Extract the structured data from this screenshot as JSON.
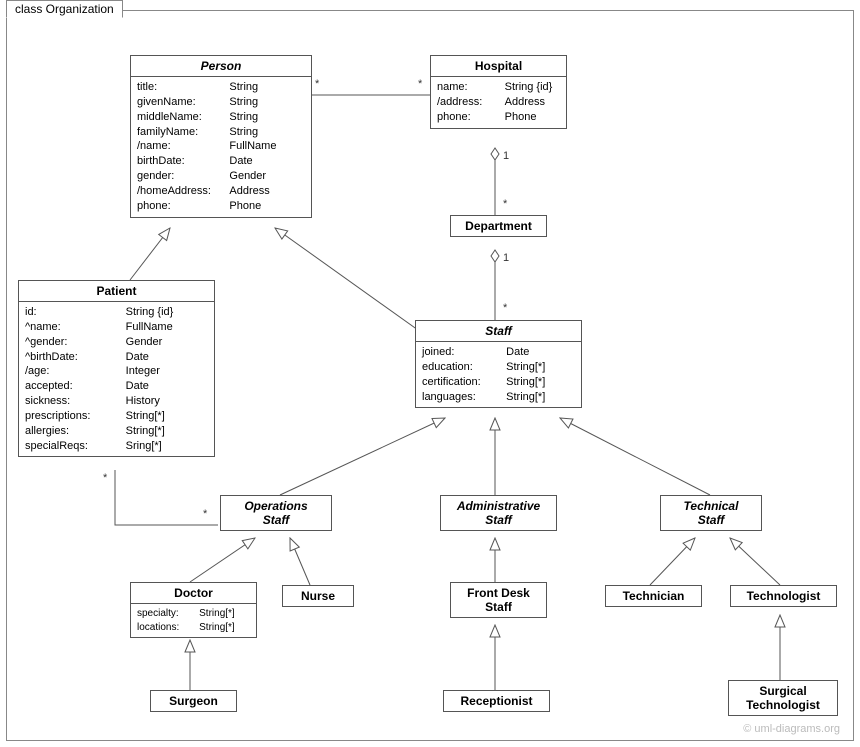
{
  "frameTitle": "class Organization",
  "watermark": "© uml-diagrams.org",
  "classes": {
    "person": {
      "name": "Person",
      "attrs": [
        {
          "n": "title:",
          "t": "String"
        },
        {
          "n": "givenName:",
          "t": "String"
        },
        {
          "n": "middleName:",
          "t": "String"
        },
        {
          "n": "familyName:",
          "t": "String"
        },
        {
          "n": "/name:",
          "t": "FullName"
        },
        {
          "n": "birthDate:",
          "t": "Date"
        },
        {
          "n": "gender:",
          "t": "Gender"
        },
        {
          "n": "/homeAddress:",
          "t": "Address"
        },
        {
          "n": "phone:",
          "t": "Phone"
        }
      ]
    },
    "hospital": {
      "name": "Hospital",
      "attrs": [
        {
          "n": "name:",
          "t": "String {id}"
        },
        {
          "n": "/address:",
          "t": "Address"
        },
        {
          "n": "phone:",
          "t": "Phone"
        }
      ]
    },
    "department": {
      "name": "Department"
    },
    "patient": {
      "name": "Patient",
      "attrs": [
        {
          "n": "id:",
          "t": "String {id}"
        },
        {
          "n": "^name:",
          "t": "FullName"
        },
        {
          "n": "^gender:",
          "t": "Gender"
        },
        {
          "n": "^birthDate:",
          "t": "Date"
        },
        {
          "n": "/age:",
          "t": "Integer"
        },
        {
          "n": "accepted:",
          "t": "Date"
        },
        {
          "n": "sickness:",
          "t": "History"
        },
        {
          "n": "prescriptions:",
          "t": "String[*]"
        },
        {
          "n": "allergies:",
          "t": "String[*]"
        },
        {
          "n": "specialReqs:",
          "t": "Sring[*]"
        }
      ]
    },
    "staff": {
      "name": "Staff",
      "attrs": [
        {
          "n": "joined:",
          "t": "Date"
        },
        {
          "n": "education:",
          "t": "String[*]"
        },
        {
          "n": "certification:",
          "t": "String[*]"
        },
        {
          "n": "languages:",
          "t": "String[*]"
        }
      ]
    },
    "opsStaff": {
      "name": "Operations Staff",
      "lines": [
        "Operations",
        "Staff"
      ]
    },
    "adminStaff": {
      "name": "Administrative Staff",
      "lines": [
        "Administrative",
        "Staff"
      ]
    },
    "techStaff": {
      "name": "Technical Staff",
      "lines": [
        "Technical",
        "Staff"
      ]
    },
    "doctor": {
      "name": "Doctor",
      "attrs": [
        {
          "n": "specialty:",
          "t": "String[*]"
        },
        {
          "n": "locations:",
          "t": "String[*]"
        }
      ]
    },
    "nurse": {
      "name": "Nurse"
    },
    "frontDesk": {
      "name": "Front Desk Staff",
      "lines": [
        "Front Desk",
        "Staff"
      ]
    },
    "technician": {
      "name": "Technician"
    },
    "technologist": {
      "name": "Technologist"
    },
    "surgeon": {
      "name": "Surgeon"
    },
    "receptionist": {
      "name": "Receptionist"
    },
    "surgicalTech": {
      "name": "Surgical Technologist",
      "lines": [
        "Surgical",
        "Technologist"
      ]
    }
  },
  "mults": {
    "personHospL": "*",
    "personHospR": "*",
    "hospDept1": "1",
    "hospDeptStar": "*",
    "deptStaff1": "1",
    "deptStaffStar": "*",
    "patientOpsL": "*",
    "patientOpsR": "*"
  }
}
